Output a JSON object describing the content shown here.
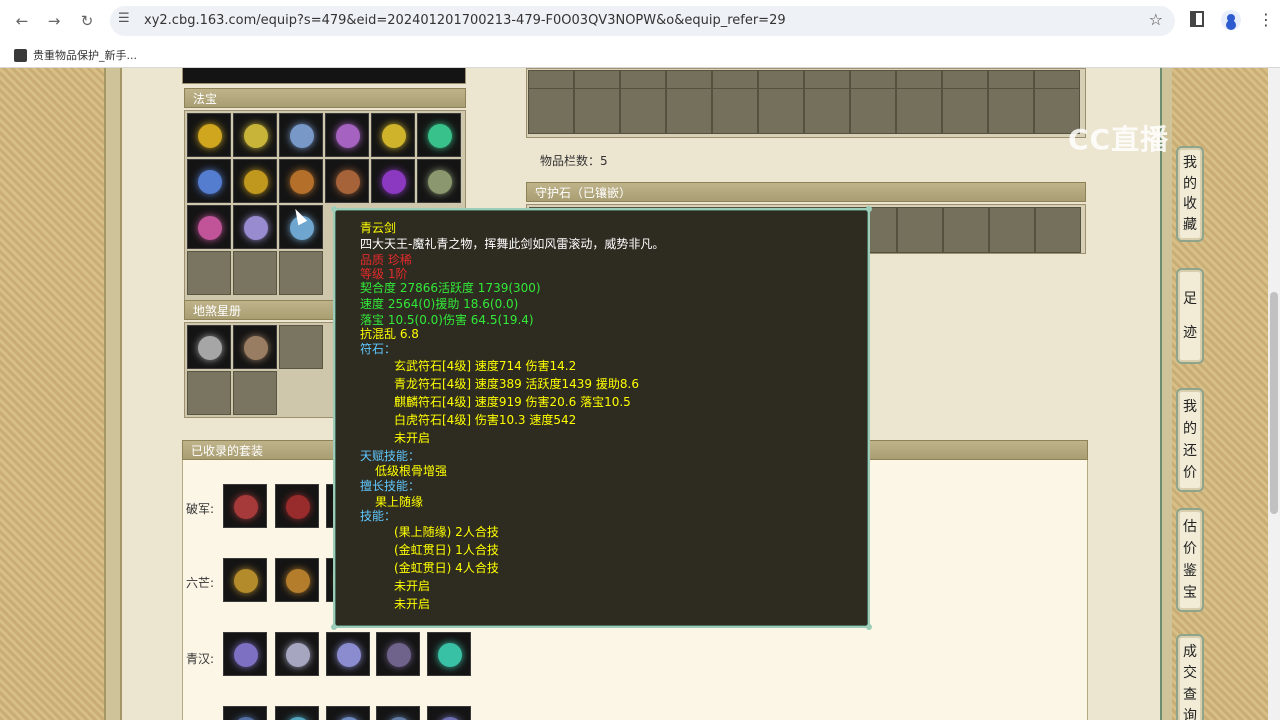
{
  "browser": {
    "url": "xy2.cbg.163.com/equip?s=479&eid=202401201700213-479-F0O03QV3NOPW&o&equip_refer=29",
    "bookmark_label": "贵重物品保护_新手..."
  },
  "watermark": "CC直播",
  "panels": {
    "fabao_title": "法宝",
    "disha_title": "地煞星册",
    "inventory_count": "物品栏数：5",
    "guard_stone_title": "守护石（已镶嵌）",
    "sets_title": "已收录的套装"
  },
  "sets": [
    {
      "label": "破军:"
    },
    {
      "label": "六芒:"
    },
    {
      "label": "青汉:"
    }
  ],
  "tooltip": {
    "name": "青云剑",
    "desc": "四大天王-魔礼青之物，挥舞此剑如风雷滚动，威势非凡。",
    "quality": "品质  珍稀",
    "level": "等级  1阶",
    "stat1": "契合度      27866活跃度   1739(300)",
    "stat2": "速度      2564(0)援助      18.6(0.0)",
    "stat3": "落宝      10.5(0.0)伤害     64.5(19.4)",
    "stat4": "抗混乱 6.8",
    "runes_title": "符石：",
    "runes": [
      "玄武符石[4级] 速度714 伤害14.2",
      "青龙符石[4级] 速度389 活跃度1439 援助8.6",
      "麒麟符石[4级] 速度919 伤害20.6 落宝10.5",
      "白虎符石[4级] 伤害10.3 速度542",
      "未开启"
    ],
    "talent_title": "天赋技能：",
    "talent": "低级根骨增强",
    "expert_title": "擅长技能：",
    "expert": "果上随缘",
    "skills_title": "技能：",
    "skills": [
      "(果上随缘) 2人合技",
      "(金虹贯日) 1人合技",
      "(金虹贯日) 4人合技",
      "未开启",
      "未开启"
    ]
  },
  "side_buttons": [
    {
      "label": "我的收藏",
      "chars": [
        "我",
        "的",
        "收",
        "藏"
      ]
    },
    {
      "label": "足迹",
      "chars": [
        "足",
        "迹"
      ]
    },
    {
      "label": "我的还价",
      "chars": [
        "我",
        "的",
        "还",
        "价"
      ]
    },
    {
      "label": "估价鉴宝",
      "chars": [
        "估",
        "价",
        "鉴",
        "宝"
      ]
    },
    {
      "label": "成交查询",
      "chars": [
        "成",
        "交",
        "查",
        "询"
      ]
    }
  ],
  "colors": {
    "tooltip_bg": "#2e2b20",
    "tooltip_border": "#9ccdb8",
    "text_yellow": "#ffff00",
    "text_green": "#32ea3a",
    "text_red": "#e22b2b",
    "text_cyan": "#5fc8ff"
  },
  "icons": [
    "back-icon",
    "forward-icon",
    "reload-icon",
    "site-settings-icon",
    "bookmark-star-icon",
    "side-panel-icon",
    "profile-icon",
    "menu-icon"
  ]
}
